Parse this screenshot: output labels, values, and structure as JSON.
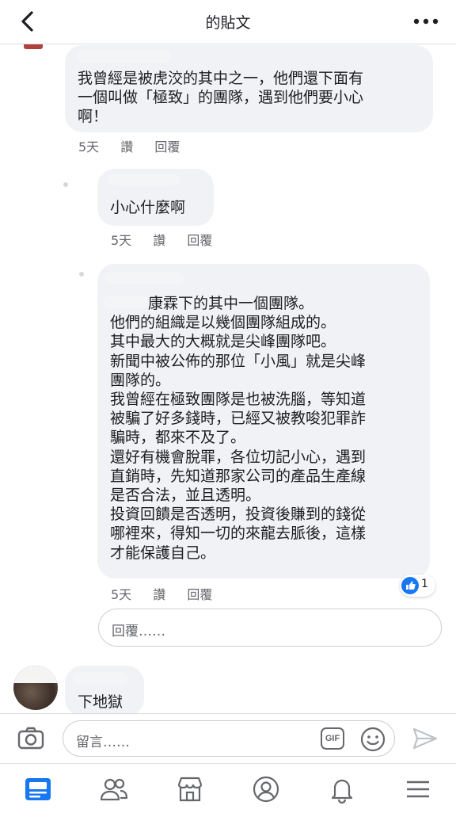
{
  "header": {
    "title": "的貼文"
  },
  "comments": [
    {
      "text_lines": [
        "我曾經是被虎洨的其中之一，他們還下面有",
        "一個叫做「極致」的團隊，遇到他們要小心",
        "啊！"
      ],
      "meta": {
        "time": "5天",
        "like": "讚",
        "reply": "回覆"
      }
    },
    {
      "text_lines": [
        "小心什麼啊"
      ],
      "meta": {
        "time": "5天",
        "like": "讚",
        "reply": "回覆"
      }
    },
    {
      "text_lines": [
        "康霖下的其中一個團隊。",
        "他們的組織是以幾個團隊組成的。",
        "其中最大的大概就是尖峰團隊吧。",
        "新聞中被公佈的那位「小風」就是尖峰",
        "團隊的。",
        "我曾經在極致團隊是也被洗腦，等知道",
        "被騙了好多錢時，已經又被教唆犯罪詐",
        "騙時，都來不及了。",
        "還好有機會脫罪，各位切記小心，遇到",
        "直銷時，先知道那家公司的產品生產線",
        "是否合法，並且透明。",
        "投資回饋是否透明，投資後賺到的錢從",
        "哪裡來，得知一切的來龍去脈後，這樣",
        "才能保護自己。"
      ],
      "meta": {
        "time": "5天",
        "like": "讚",
        "reply": "回覆"
      },
      "reaction_count": "1"
    },
    {
      "text_lines": [
        "下地獄"
      ]
    }
  ],
  "reply_box": {
    "placeholder": "回覆……"
  },
  "composer": {
    "placeholder": "留言……",
    "gif_label": "GIF"
  },
  "colors": {
    "accent": "#1877f2",
    "bubble": "#f0f2f5",
    "meta": "#65676b"
  },
  "tabs": [
    "news-feed-icon",
    "friends-icon",
    "marketplace-icon",
    "profile-icon",
    "notifications-icon",
    "menu-icon"
  ]
}
